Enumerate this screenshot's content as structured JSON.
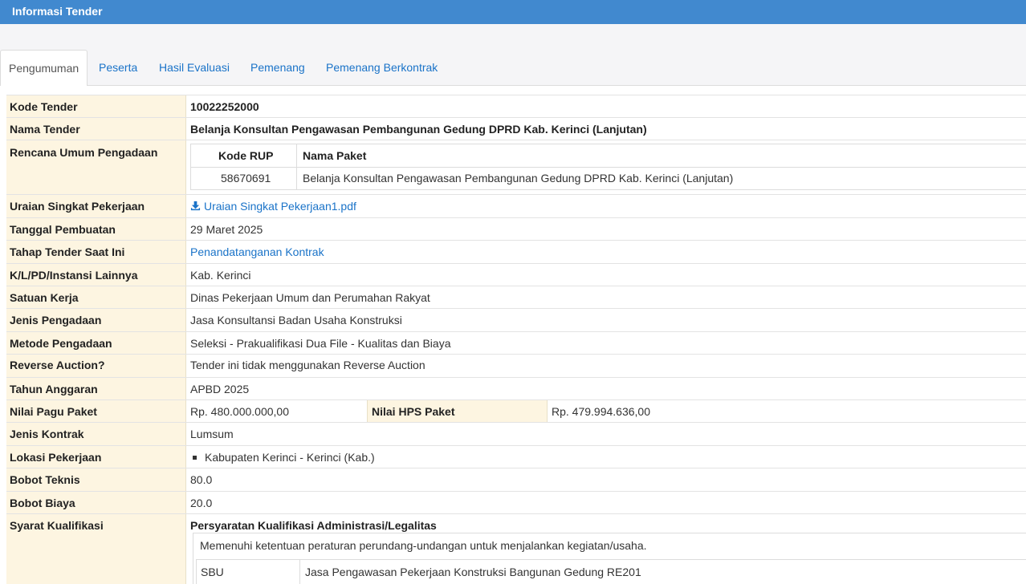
{
  "header": {
    "title": "Informasi Tender"
  },
  "tabs": [
    {
      "label": "Pengumuman",
      "active": true
    },
    {
      "label": "Peserta"
    },
    {
      "label": "Hasil Evaluasi"
    },
    {
      "label": "Pemenang"
    },
    {
      "label": "Pemenang Berkontrak"
    }
  ],
  "fields": {
    "kode_tender": {
      "label": "Kode Tender",
      "value": "10022252000"
    },
    "nama_tender": {
      "label": "Nama Tender",
      "value": "Belanja Konsultan Pengawasan Pembangunan Gedung DPRD Kab. Kerinci (Lanjutan)"
    },
    "rencana_umum": {
      "label": "Rencana Umum Pengadaan",
      "headers": [
        "Kode RUP",
        "Nama Paket"
      ],
      "rows": [
        [
          "58670691",
          "Belanja Konsultan Pengawasan Pembangunan Gedung DPRD Kab. Kerinci (Lanjutan)"
        ]
      ]
    },
    "uraian": {
      "label": "Uraian Singkat Pekerjaan",
      "value": "Uraian Singkat Pekerjaan1.pdf"
    },
    "tanggal": {
      "label": "Tanggal Pembuatan",
      "value": "29 Maret 2025"
    },
    "tahap": {
      "label": "Tahap Tender Saat Ini",
      "value": "Penandatanganan Kontrak"
    },
    "instansi": {
      "label": "K/L/PD/Instansi Lainnya",
      "value": "Kab. Kerinci"
    },
    "satker": {
      "label": "Satuan Kerja",
      "value": "Dinas Pekerjaan Umum dan Perumahan Rakyat"
    },
    "jenis_pengadaan": {
      "label": "Jenis Pengadaan",
      "value": "Jasa Konsultansi Badan Usaha Konstruksi"
    },
    "metode": {
      "label": "Metode Pengadaan",
      "value": "Seleksi - Prakualifikasi Dua File - Kualitas dan Biaya"
    },
    "reverse": {
      "label": "Reverse Auction?",
      "value": "Tender ini tidak menggunakan Reverse Auction"
    },
    "tahun": {
      "label": "Tahun Anggaran",
      "value": "APBD 2025"
    },
    "pagu": {
      "label": "Nilai Pagu Paket",
      "value": "Rp. 480.000.000,00"
    },
    "hps": {
      "label": "Nilai HPS Paket",
      "value": "Rp. 479.994.636,00"
    },
    "jenis_kontrak": {
      "label": "Jenis Kontrak",
      "value": "Lumsum"
    },
    "lokasi": {
      "label": "Lokasi Pekerjaan",
      "value": "Kabupaten Kerinci - Kerinci (Kab.)"
    },
    "bobot_teknis": {
      "label": "Bobot Teknis",
      "value": "80.0"
    },
    "bobot_biaya": {
      "label": "Bobot Biaya",
      "value": "20.0"
    },
    "syarat": {
      "label": "Syarat Kualifikasi",
      "heading": "Persyaratan Kualifikasi Administrasi/Legalitas",
      "note": "Memenuhi ketentuan peraturan perundang-undangan untuk menjalankan kegiatan/usaha.",
      "sbu_label": "SBU",
      "sbu_value": "Jasa Pengawasan Pekerjaan Konstruksi Bangunan Gedung RE201"
    }
  },
  "colors": {
    "header_bg": "#4189cf",
    "label_bg": "#fdf5e1",
    "link": "#1a73c8"
  }
}
